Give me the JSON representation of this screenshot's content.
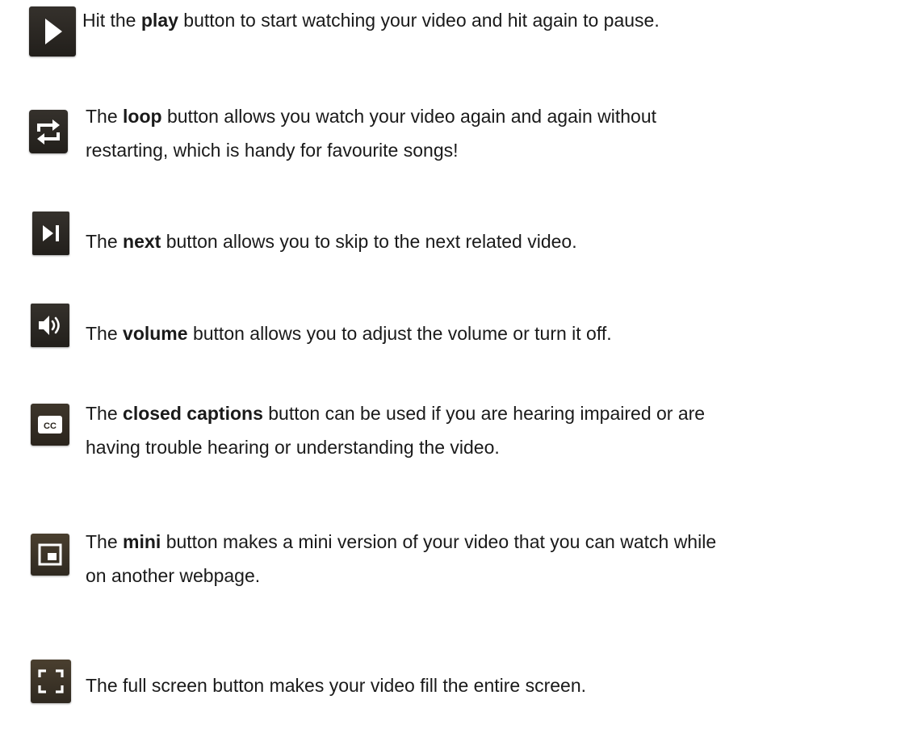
{
  "colors": {
    "icon_background": "#2b2722",
    "icon_glyph": "#ffffff",
    "text": "#1a1a1a"
  },
  "items": [
    {
      "icon": "play-icon",
      "lines": [
        {
          "before": "Hit the ",
          "bold": "play",
          "after": " button to start watching your video and hit again to pause."
        }
      ]
    },
    {
      "icon": "loop-icon",
      "lines": [
        {
          "before": "The ",
          "bold": "loop",
          "after": " button allows you watch your video again and again without"
        },
        {
          "before": "restarting, which is handy for favourite songs!",
          "bold": "",
          "after": ""
        }
      ]
    },
    {
      "icon": "next-icon",
      "lines": [
        {
          "before": "The ",
          "bold": "next",
          "after": " button allows you to skip to the next related video."
        }
      ]
    },
    {
      "icon": "volume-icon",
      "lines": [
        {
          "before": "The ",
          "bold": "volume",
          "after": " button allows you to adjust the volume or turn it off."
        }
      ]
    },
    {
      "icon": "closed-captions-icon",
      "icon_label": "CC",
      "lines": [
        {
          "before": "The ",
          "bold": "closed captions",
          "after": " button can be used if you are hearing impaired or are"
        },
        {
          "before": "having trouble hearing or understanding the video.",
          "bold": "",
          "after": ""
        }
      ]
    },
    {
      "icon": "mini-player-icon",
      "lines": [
        {
          "before": "The ",
          "bold": "mini",
          "after": " button makes a mini version of your video that you can watch while"
        },
        {
          "before": "on another webpage.",
          "bold": "",
          "after": ""
        }
      ]
    },
    {
      "icon": "fullscreen-icon",
      "lines": [
        {
          "before": "The full screen button makes your video fill the entire screen.",
          "bold": "",
          "after": ""
        }
      ]
    }
  ]
}
